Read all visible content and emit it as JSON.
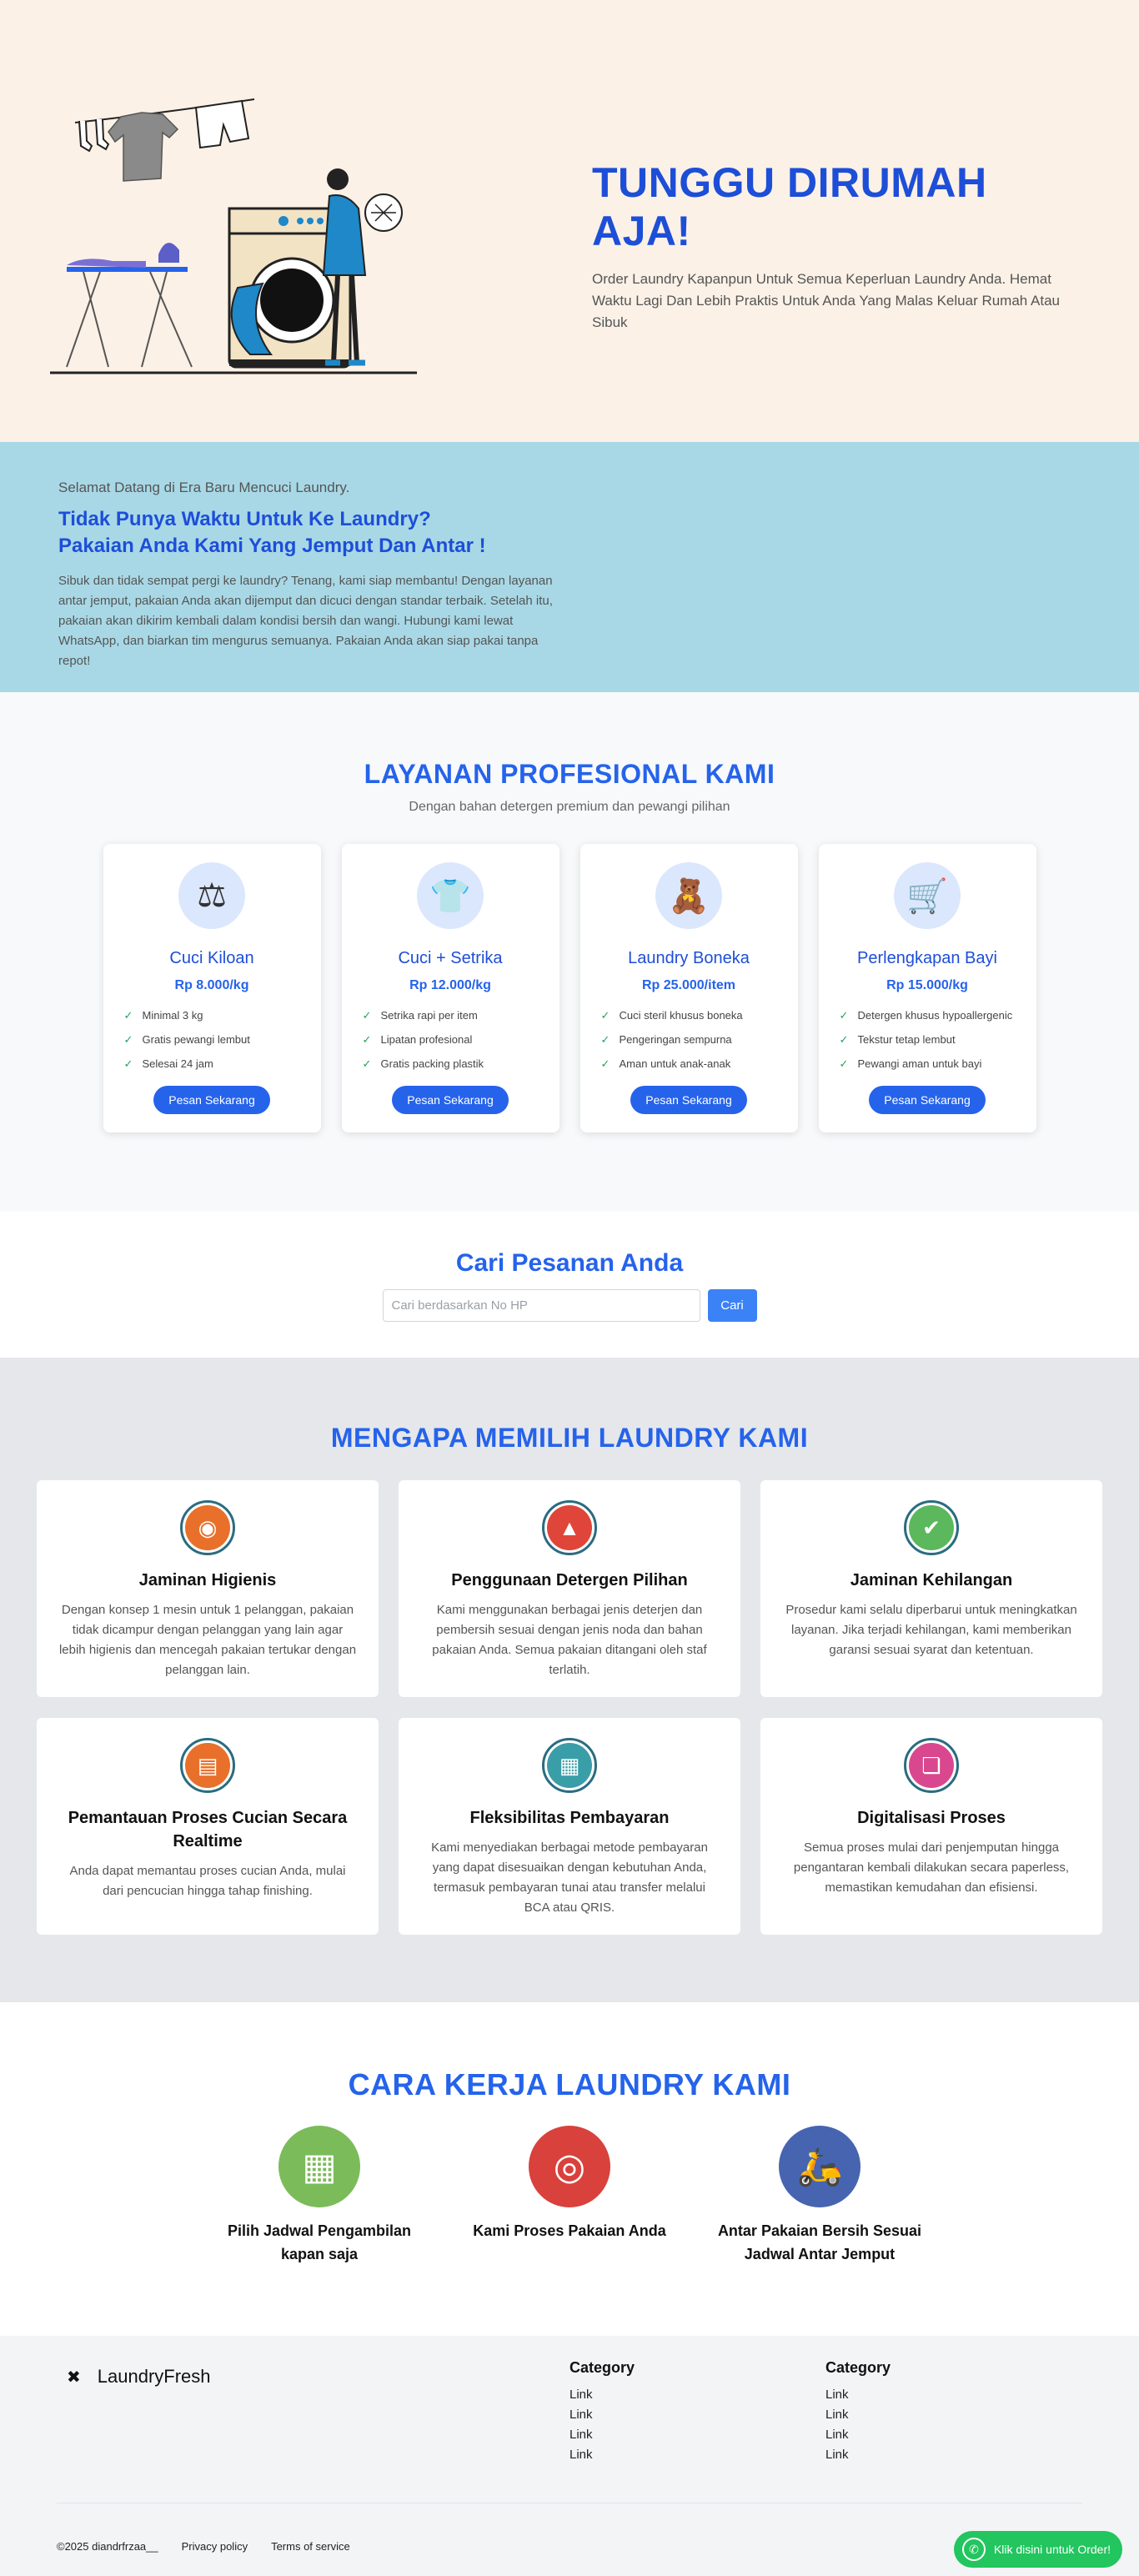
{
  "hero": {
    "title": "TUNGGU DIRUMAH AJA!",
    "subtitle": "Order Laundry Kapanpun Untuk Semua Keperluan Laundry Anda. Hemat Waktu Lagi Dan Lebih Praktis Untuk Anda Yang Malas Keluar Rumah Atau Sibuk",
    "illustration_icon": "laundry-illustration"
  },
  "welcome": {
    "greeting": "Selamat Datang di Era Baru Mencuci Laundry.",
    "title_line1": "Tidak Punya Waktu Untuk Ke Laundry?",
    "title_line2": "Pakaian Anda Kami Yang Jemput Dan Antar !",
    "description": "Sibuk dan tidak sempat pergi ke laundry? Tenang, kami siap membantu! Dengan layanan antar jemput, pakaian Anda akan dijemput dan dicuci dengan standar terbaik. Setelah itu, pakaian akan dikirim kembali dalam kondisi bersih dan wangi. Hubungi kami lewat WhatsApp, dan biarkan tim mengurus semuanya. Pakaian Anda akan siap pakai tanpa repot!"
  },
  "services": {
    "title": "LAYANAN PROFESIONAL KAMI",
    "subtitle": "Dengan bahan detergen premium dan pewangi pilihan",
    "order_label": "Pesan Sekarang",
    "items": [
      {
        "icon": "scale-icon",
        "glyph": "⚖",
        "name": "Cuci Kiloan",
        "price": "Rp 8.000/kg",
        "features": [
          "Minimal 3 kg",
          "Gratis pewangi lembut",
          "Selesai 24 jam"
        ]
      },
      {
        "icon": "shirt-icon",
        "glyph": "👕",
        "name": "Cuci + Setrika",
        "price": "Rp 12.000/kg",
        "features": [
          "Setrika rapi per item",
          "Lipatan profesional",
          "Gratis packing plastik"
        ]
      },
      {
        "icon": "teddy-bear-icon",
        "glyph": "🧸",
        "name": "Laundry Boneka",
        "price": "Rp 25.000/item",
        "features": [
          "Cuci steril khusus boneka",
          "Pengeringan sempurna",
          "Aman untuk anak-anak"
        ]
      },
      {
        "icon": "stroller-icon",
        "glyph": "🛒",
        "name": "Perlengkapan Bayi",
        "price": "Rp 15.000/kg",
        "features": [
          "Detergen khusus hypoallergenic",
          "Tekstur tetap lembut",
          "Pewangi aman untuk bayi"
        ]
      }
    ]
  },
  "search": {
    "title": "Cari Pesanan Anda",
    "placeholder": "Cari berdasarkan No HP",
    "button_label": "Cari"
  },
  "why": {
    "title": "MENGAPA MEMILIH LAUNDRY KAMI",
    "items": [
      {
        "icon": "washing-machine-icon",
        "glyph": "◉",
        "color": "#e8702a",
        "title": "Jaminan Higienis",
        "desc": "Dengan konsep 1 mesin untuk 1 pelanggan, pakaian tidak dicampur dengan pelanggan yang lain agar lebih higienis dan mencegah pakaian tertukar dengan pelanggan lain."
      },
      {
        "icon": "detergent-icon",
        "glyph": "▲",
        "color": "#e0453a",
        "title": "Penggunaan Detergen Pilihan",
        "desc": "Kami menggunakan berbagai jenis deterjen dan pembersih sesuai dengan jenis noda dan bahan pakaian Anda. Semua pakaian ditangani oleh staf terlatih."
      },
      {
        "icon": "check-icon",
        "glyph": "✔",
        "color": "#5cb85c",
        "title": "Jaminan Kehilangan",
        "desc": "Prosedur kami selalu diperbarui untuk meningkatkan layanan. Jika terjadi kehilangan, kami memberikan garansi sesuai syarat dan ketentuan."
      },
      {
        "icon": "clipboard-icon",
        "glyph": "▤",
        "color": "#e8702a",
        "title": "Pemantauan Proses Cucian Secara Realtime",
        "desc": "Anda dapat memantau proses cucian Anda, mulai dari pencucian hingga tahap finishing."
      },
      {
        "icon": "payment-icon",
        "glyph": "▦",
        "color": "#3a9ea8",
        "title": "Fleksibilitas Pembayaran",
        "desc": "Kami menyediakan berbagai metode pembayaran yang dapat disesuaikan dengan kebutuhan Anda, termasuk pembayaran tunai atau transfer melalui BCA atau QRIS."
      },
      {
        "icon": "document-icon",
        "glyph": "❏",
        "color": "#d9488f",
        "title": "Digitalisasi Proses",
        "desc": "Semua proses mulai dari penjemputan hingga pengantaran kembali dilakukan secara paperless, memastikan kemudahan dan efisiensi."
      }
    ]
  },
  "how": {
    "title": "CARA KERJA LAUNDRY KAMI",
    "steps": [
      {
        "icon": "calendar-icon",
        "glyph": "▦",
        "color": "#7cbb5a",
        "label": "Pilih Jadwal Pengambilan kapan saja"
      },
      {
        "icon": "washing-machine-icon",
        "glyph": "◎",
        "color": "#d9413c",
        "label": "Kami Proses Pakaian Anda"
      },
      {
        "icon": "scooter-icon",
        "glyph": "🛵",
        "color": "#4664b0",
        "label": "Antar Pakaian Bersih Sesuai Jadwal Antar Jemput"
      }
    ]
  },
  "footer": {
    "brand_icon": "logo-icon",
    "brand_glyph": "✖",
    "brand_name": "LaundryFresh",
    "columns": [
      {
        "title": "Category",
        "links": [
          "Link",
          "Link",
          "Link",
          "Link"
        ]
      },
      {
        "title": "Category",
        "links": [
          "Link",
          "Link",
          "Link",
          "Link"
        ]
      }
    ],
    "copyright": "©2025 diandrfrzaa__",
    "privacy": "Privacy policy",
    "terms": "Terms of service",
    "whatsapp_label": "Klik disini untuk Order!",
    "whatsapp_icon": "whatsapp-icon"
  },
  "colors": {
    "primary": "#2563eb",
    "hero_bg": "#fbf1e7",
    "welcome_bg": "#a8d8e6",
    "whatsapp": "#22c55e"
  }
}
